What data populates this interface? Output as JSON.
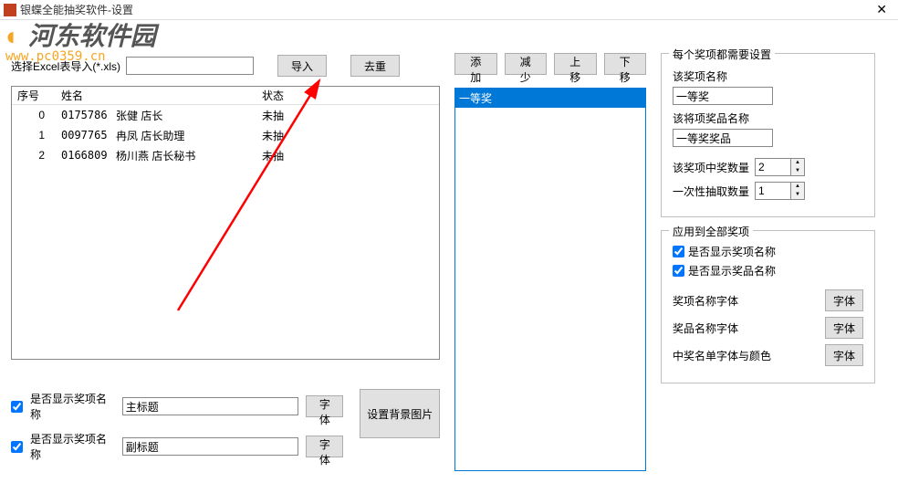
{
  "window": {
    "title": "银蝶全能抽奖软件-设置"
  },
  "watermark": {
    "text": "河东软件园",
    "url": "www.pc0359.cn"
  },
  "import": {
    "label": "选择Excel表导入(*.xls)",
    "value": "",
    "import_btn": "导入",
    "dedupe_btn": "去重"
  },
  "table": {
    "h1": "序号",
    "h2": "姓名",
    "h3": "状态",
    "rows": [
      {
        "idx": "0",
        "code": "0175786",
        "name": "张健  店长",
        "status": "未抽"
      },
      {
        "idx": "1",
        "code": "0097765",
        "name": "冉凤  店长助理",
        "status": "未抽"
      },
      {
        "idx": "2",
        "code": "0166809",
        "name": "杨川燕  店长秘书",
        "status": "未抽"
      }
    ]
  },
  "list_btns": {
    "add": "添加",
    "remove": "减少",
    "up": "上移",
    "down": "下移"
  },
  "prize_list": {
    "items": [
      "一等奖"
    ],
    "selected": 0
  },
  "group1": {
    "legend": "每个奖项都需要设置",
    "name_label": "该奖项名称",
    "name_value": "一等奖",
    "item_label": "该将项奖品名称",
    "item_value": "一等奖奖品",
    "count_label": "该奖项中奖数量",
    "count_value": "2",
    "once_label": "一次性抽取数量",
    "once_value": "1"
  },
  "group2": {
    "legend": "应用到全部奖项",
    "show_name": "是否显示奖项名称",
    "show_item": "是否显示奖品名称",
    "font_name": "奖项名称字体",
    "font_item": "奖品名称字体",
    "font_winner": "中奖名单字体与颜色",
    "font_btn": "字体"
  },
  "bottom": {
    "chk1": "是否显示奖项名称",
    "val1": "主标题",
    "chk2": "是否显示奖项名称",
    "val2": "副标题",
    "font_btn": "字体",
    "bg_btn": "设置背景图片"
  }
}
